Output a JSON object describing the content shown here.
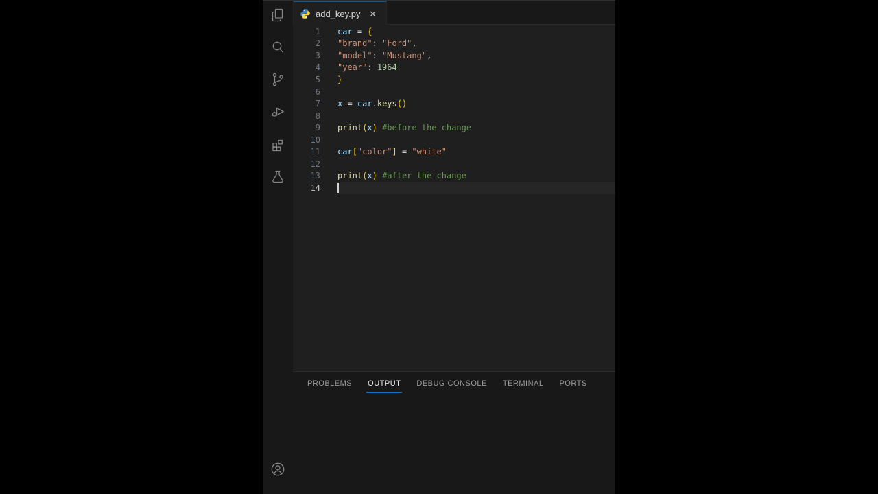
{
  "activity_bar": {
    "icons": [
      "files-icon",
      "search-icon",
      "source-control-icon",
      "run-debug-icon",
      "extensions-icon",
      "testing-icon"
    ],
    "bottom_icons": [
      "account-icon"
    ]
  },
  "tab_bar": {
    "tabs": [
      {
        "label": "add_key.py",
        "icon": "python-icon",
        "close_glyph": "✕",
        "active": true
      }
    ]
  },
  "editor": {
    "language": "python",
    "token_colors": {
      "v": "#9CDCFE",
      "s": "#CE9178",
      "n": "#B5CEA8",
      "f": "#DCDCAA",
      "b": "#FFD700",
      "c": "#6A9955",
      "p": "#CCCCCC"
    },
    "lines": [
      {
        "n": "1",
        "tokens": [
          [
            "car",
            "v"
          ],
          [
            " = ",
            "p"
          ],
          [
            "{",
            "b"
          ]
        ]
      },
      {
        "n": "2",
        "tokens": [
          [
            "\"brand\"",
            "s"
          ],
          [
            ": ",
            "p"
          ],
          [
            "\"Ford\"",
            "s"
          ],
          [
            ",",
            "p"
          ]
        ]
      },
      {
        "n": "3",
        "tokens": [
          [
            "\"model\"",
            "s"
          ],
          [
            ": ",
            "p"
          ],
          [
            "\"Mustang\"",
            "s"
          ],
          [
            ",",
            "p"
          ]
        ]
      },
      {
        "n": "4",
        "tokens": [
          [
            "\"year\"",
            "s"
          ],
          [
            ": ",
            "p"
          ],
          [
            "1964",
            "n"
          ]
        ]
      },
      {
        "n": "5",
        "tokens": [
          [
            "}",
            "b"
          ]
        ]
      },
      {
        "n": "6",
        "tokens": []
      },
      {
        "n": "7",
        "tokens": [
          [
            "x",
            "v"
          ],
          [
            " = ",
            "p"
          ],
          [
            "car",
            "v"
          ],
          [
            ".",
            "p"
          ],
          [
            "keys",
            "f"
          ],
          [
            "()",
            "b"
          ]
        ]
      },
      {
        "n": "8",
        "tokens": []
      },
      {
        "n": "9",
        "tokens": [
          [
            "print",
            "f"
          ],
          [
            "(",
            "b"
          ],
          [
            "x",
            "v"
          ],
          [
            ")",
            "b"
          ],
          [
            " ",
            "p"
          ],
          [
            "#before the change",
            "c"
          ]
        ]
      },
      {
        "n": "10",
        "tokens": []
      },
      {
        "n": "11",
        "tokens": [
          [
            "car",
            "v"
          ],
          [
            "[",
            "b"
          ],
          [
            "\"color\"",
            "s"
          ],
          [
            "]",
            "b"
          ],
          [
            " = ",
            "p"
          ],
          [
            "\"white\"",
            "s"
          ]
        ]
      },
      {
        "n": "12",
        "tokens": []
      },
      {
        "n": "13",
        "tokens": [
          [
            "print",
            "f"
          ],
          [
            "(",
            "b"
          ],
          [
            "x",
            "v"
          ],
          [
            ")",
            "b"
          ],
          [
            " ",
            "p"
          ],
          [
            "#after the change",
            "c"
          ]
        ]
      },
      {
        "n": "14",
        "tokens": [],
        "cursor": true,
        "active": true
      }
    ]
  },
  "panel": {
    "tabs": [
      {
        "label": "PROBLEMS",
        "active": false
      },
      {
        "label": "OUTPUT",
        "active": true
      },
      {
        "label": "DEBUG CONSOLE",
        "active": false
      },
      {
        "label": "TERMINAL",
        "active": false
      },
      {
        "label": "PORTS",
        "active": false
      }
    ]
  },
  "colors": {
    "stage_background": "#000000",
    "editor_background": "#1f1f1f",
    "activity_bar_background": "#181818",
    "panel_background": "#181818",
    "active_tab_top_border": "#20547d",
    "panel_active_underline": "#0e70c0"
  }
}
